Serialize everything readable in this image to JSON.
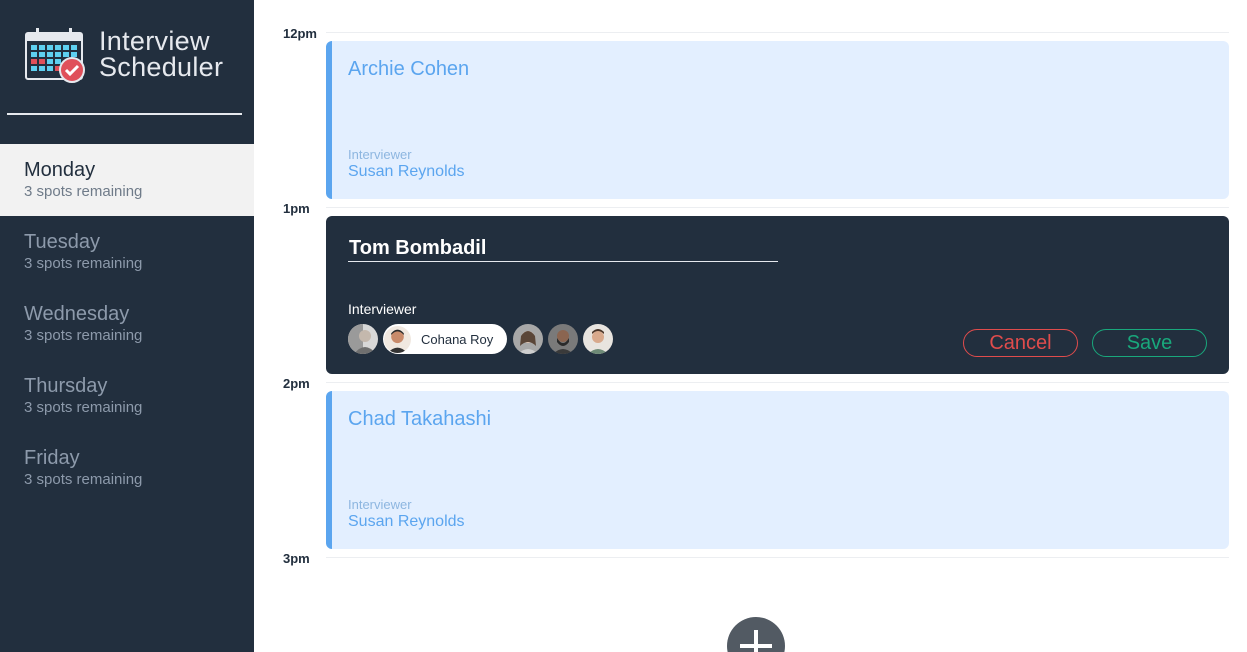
{
  "app": {
    "title_line1": "Interview",
    "title_line2": "Scheduler"
  },
  "days": [
    {
      "name": "Monday",
      "spots": "3 spots remaining",
      "selected": true
    },
    {
      "name": "Tuesday",
      "spots": "3 spots remaining",
      "selected": false
    },
    {
      "name": "Wednesday",
      "spots": "3 spots remaining",
      "selected": false
    },
    {
      "name": "Thursday",
      "spots": "3 spots remaining",
      "selected": false
    },
    {
      "name": "Friday",
      "spots": "3 spots remaining",
      "selected": false
    }
  ],
  "times": [
    "12pm",
    "1pm",
    "2pm",
    "3pm"
  ],
  "appointments": [
    {
      "student": "Archie Cohen",
      "interviewer_label": "Interviewer",
      "interviewer": "Susan Reynolds"
    },
    {
      "student_value": "Tom Bombadil",
      "interviewer_label": "Interviewer",
      "selected_interviewer": "Cohana Roy",
      "cancel_label": "Cancel",
      "save_label": "Save"
    },
    {
      "student": "Chad Takahashi",
      "interviewer_label": "Interviewer",
      "interviewer": "Susan Reynolds"
    }
  ],
  "colors": {
    "sidebar": "#222f3e",
    "accent_blue": "#5ba5ef",
    "appointment_bg": "#e3efff",
    "danger": "#e04c4c",
    "success": "#19a87c"
  },
  "icons": {
    "logo": "calendar-check-icon",
    "add": "plus-icon"
  }
}
